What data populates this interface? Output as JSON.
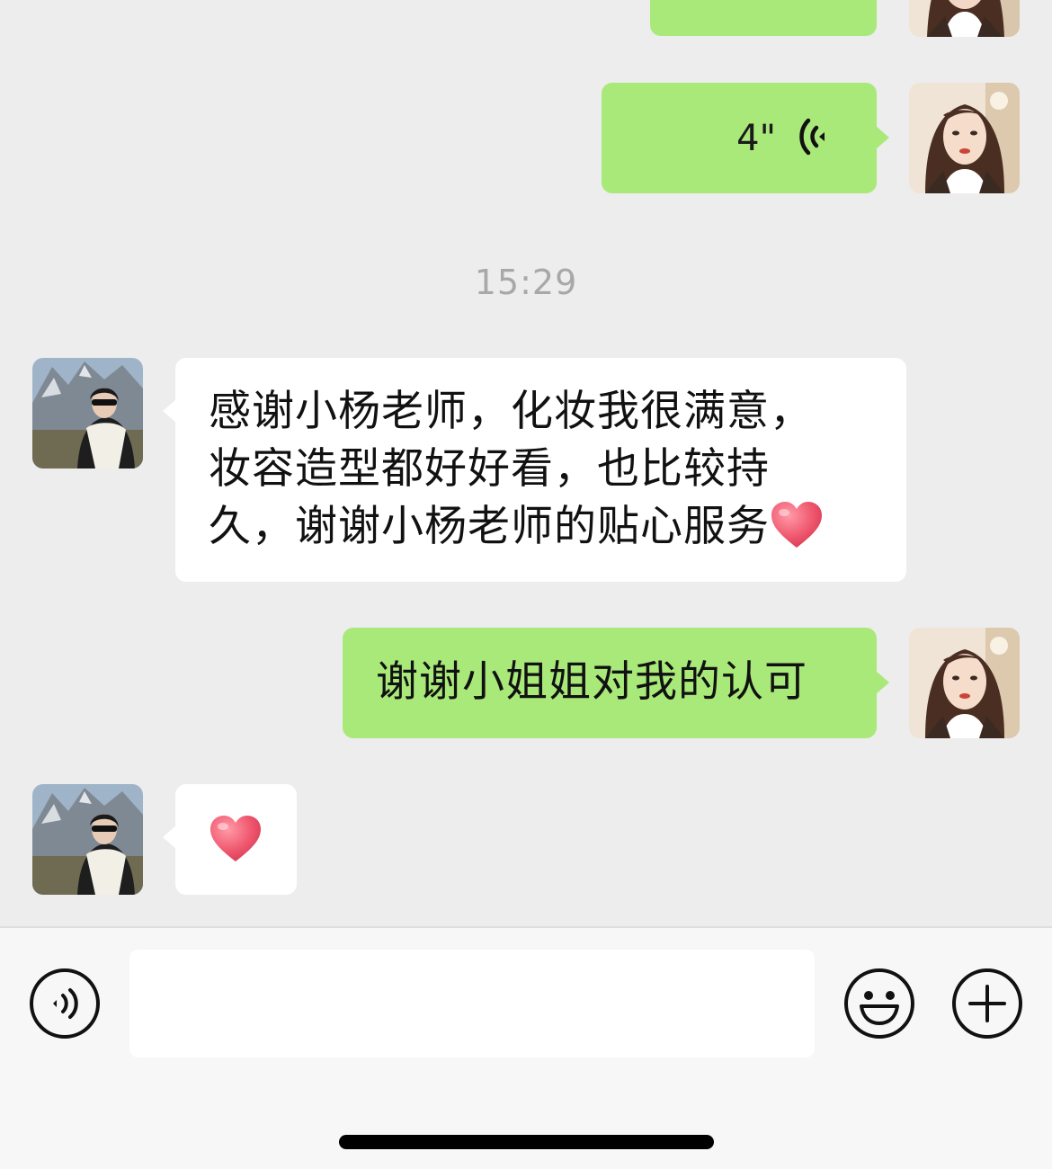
{
  "chat": {
    "messages": [
      {
        "id": "m0",
        "sender": "me",
        "type": "voice",
        "partially_visible": true
      },
      {
        "id": "m1",
        "sender": "me",
        "type": "voice",
        "duration": "4\""
      },
      {
        "id": "ts1",
        "type": "timestamp",
        "text": "15:29"
      },
      {
        "id": "m2",
        "sender": "other",
        "type": "text",
        "lines": [
          "感谢小杨老师，化妆我很满意，",
          "妆容造型都好好看，也比较持",
          "久，谢谢小杨老师的贴心服务"
        ],
        "trailing_emoji": "heart-emoji"
      },
      {
        "id": "m3",
        "sender": "me",
        "type": "text",
        "text": "谢谢小姐姐对我的认可"
      },
      {
        "id": "m4",
        "sender": "other",
        "type": "emoji",
        "emoji": "heart-emoji"
      }
    ]
  },
  "input_bar": {
    "text_value": "",
    "left_icon": "voice-mode-icon",
    "right_icons": [
      "emoji-face-icon",
      "plus-icon"
    ]
  },
  "colors": {
    "chat_background": "#ededed",
    "my_bubble": "#a9e97a",
    "other_bubble": "#ffffff",
    "timestamp_text": "#a8a8a8",
    "input_bar_background": "#f7f7f7"
  }
}
